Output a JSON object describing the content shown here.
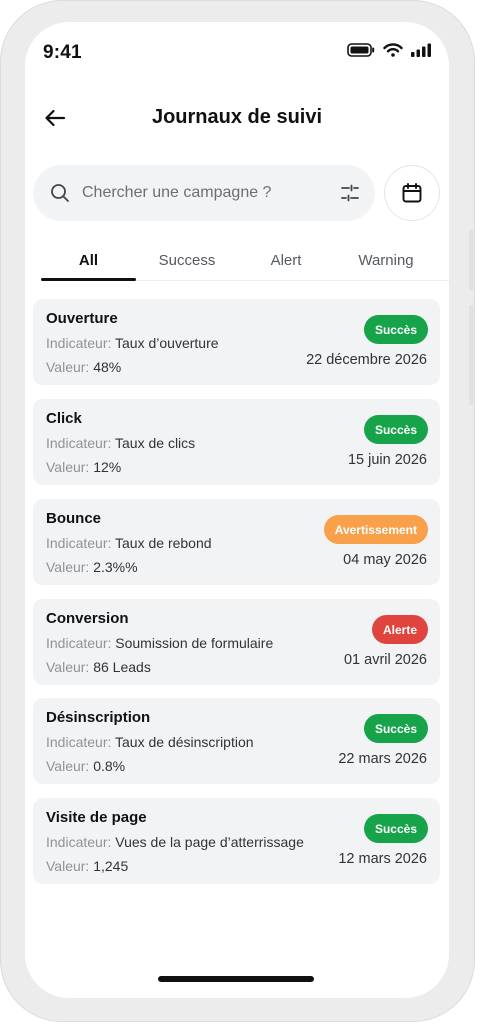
{
  "status_bar": {
    "time": "9:41"
  },
  "header": {
    "title": "Journaux de suivi"
  },
  "search": {
    "placeholder": "Chercher une campagne ?"
  },
  "tabs": [
    {
      "label": "All",
      "active": true
    },
    {
      "label": "Success",
      "active": false
    },
    {
      "label": "Alert",
      "active": false
    },
    {
      "label": "Warning",
      "active": false
    }
  ],
  "labels": {
    "indicator": "Indicateur:",
    "value": "Valeur:"
  },
  "logs": [
    {
      "name": "Ouverture",
      "indicator": "Taux d’ouverture",
      "value": "48%",
      "status": "Succès",
      "status_type": "success",
      "date": "22 décembre 2026"
    },
    {
      "name": "Click",
      "indicator": "Taux de clics",
      "value": "12%",
      "status": "Succès",
      "status_type": "success",
      "date": "15 juin 2026"
    },
    {
      "name": "Bounce",
      "indicator": "Taux de rebond",
      "value": "2.3%%",
      "status": "Avertissement",
      "status_type": "warning",
      "date": "04 may 2026"
    },
    {
      "name": "Conversion",
      "indicator": "Soumission de formulaire",
      "value": "86 Leads",
      "status": "Alerte",
      "status_type": "alert",
      "date": "01 avril 2026"
    },
    {
      "name": "Désinscription",
      "indicator": "Taux de désinscription",
      "value": "0.8%",
      "status": "Succès",
      "status_type": "success",
      "date": "22 mars 2026"
    },
    {
      "name": "Visite de page",
      "indicator": "Vues de la page d’atterrissage",
      "value": "1,245",
      "status": "Succès",
      "status_type": "success",
      "date": "12 mars 2026"
    }
  ],
  "colors": {
    "success": "#16a34a",
    "warning": "#f8a04a",
    "alert": "#e0443e",
    "card_bg": "#f2f3f5"
  }
}
